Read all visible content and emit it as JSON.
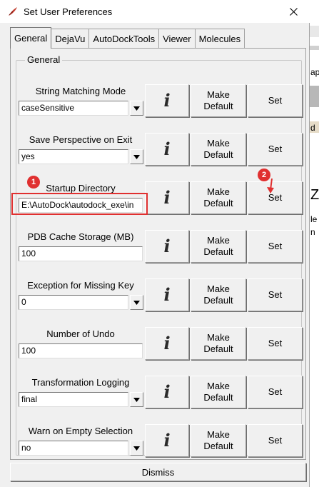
{
  "window": {
    "title": "Set User Preferences",
    "app_icon": "tk-feather-icon",
    "close_icon": "close-icon"
  },
  "tabs": [
    {
      "label": "General",
      "active": true
    },
    {
      "label": "DejaVu"
    },
    {
      "label": "AutoDockTools"
    },
    {
      "label": "Viewer"
    },
    {
      "label": "Molecules"
    }
  ],
  "group": {
    "label": "General"
  },
  "buttons": {
    "info_glyph": "i",
    "make_default": [
      "Make",
      "Default"
    ],
    "set": "Set"
  },
  "rows": [
    {
      "label": "String Matching Mode",
      "value": "caseSensitive",
      "kind": "dropdown"
    },
    {
      "label": "Save Perspective on Exit",
      "value": "yes",
      "kind": "dropdown"
    },
    {
      "label": "Startup Directory",
      "value": "E:\\AutoDock\\autodock_exe\\in",
      "kind": "entry"
    },
    {
      "label": "PDB Cache Storage (MB)",
      "value": "100",
      "kind": "entry"
    },
    {
      "label": "Exception for Missing Key",
      "value": "0",
      "kind": "dropdown"
    },
    {
      "label": "Number of Undo",
      "value": "100",
      "kind": "entry"
    },
    {
      "label": "Transformation Logging",
      "value": "final",
      "kind": "dropdown"
    },
    {
      "label": "Warn on Empty Selection",
      "value": "no",
      "kind": "dropdown"
    }
  ],
  "dismiss": "Dismiss",
  "annotations": {
    "marker1": "1",
    "marker2": "2",
    "highlight_color": "#e03030"
  },
  "background_fragments": [
    "ap",
    "d",
    "le",
    "Z",
    "n"
  ]
}
